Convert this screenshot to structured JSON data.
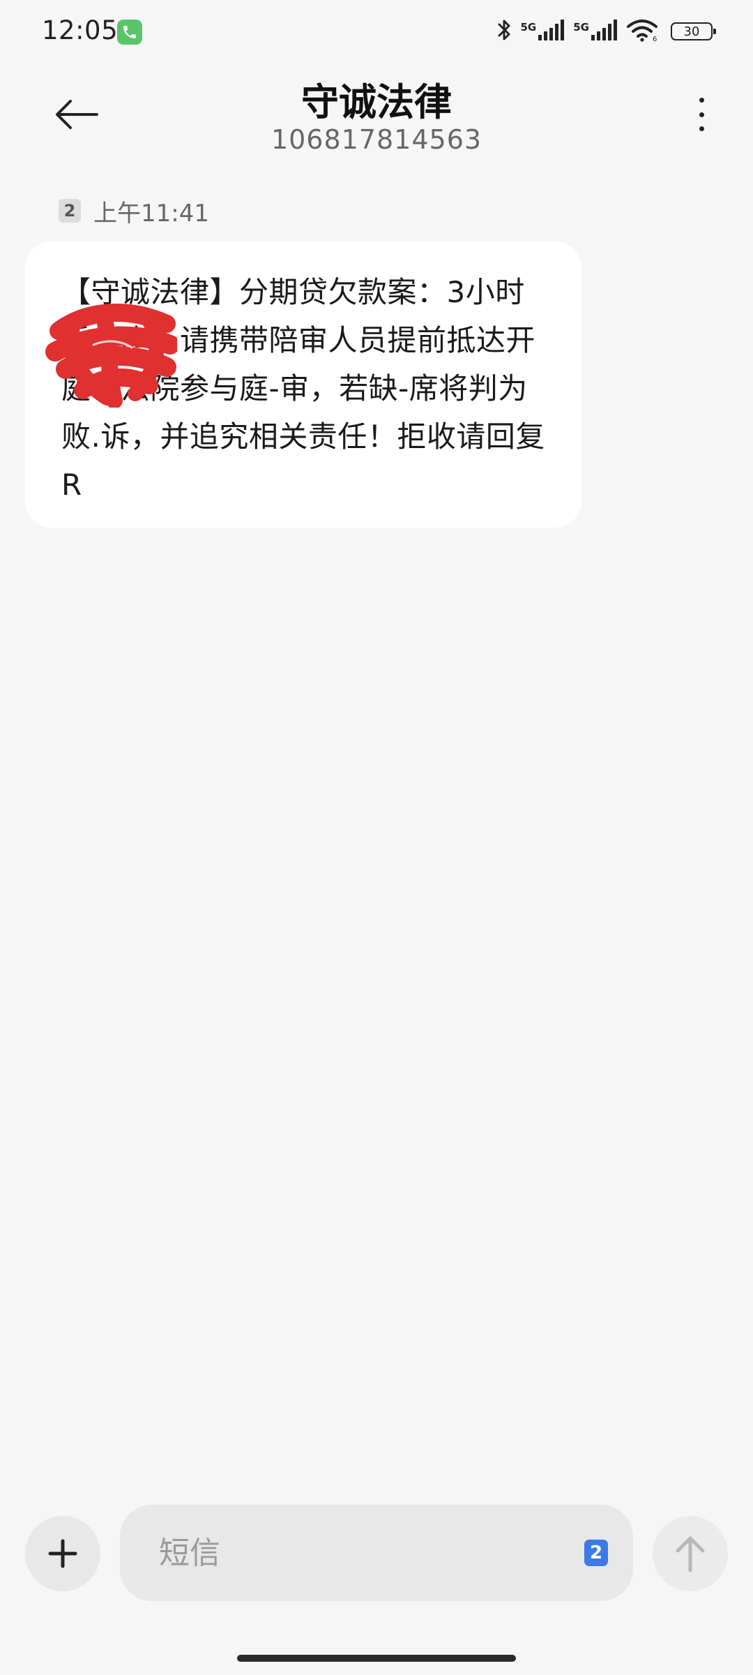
{
  "status_bar": {
    "time": "12:05",
    "network_1": "5G",
    "network_2": "5G",
    "battery": "30",
    "icons": [
      "phone-call-icon",
      "bluetooth-icon",
      "signal-icon",
      "signal-icon",
      "wifi-icon",
      "battery-icon"
    ]
  },
  "header": {
    "back_icon": "arrow-left-icon",
    "contact_name": "守诚法律",
    "contact_number": "106817814563",
    "more_icon": "more-vertical-icon"
  },
  "messages": [
    {
      "sim": "2",
      "time": "上午11:41",
      "text": "【守诚法律】分期贷欠款案：3小时后上庭，请携带陪审人员提前抵达开庭地法院参与庭-审，若缺-席将判为败.诉，并追究相关责任！拒收请回复R",
      "redacted": true
    }
  ],
  "composer": {
    "add_icon": "plus-icon",
    "placeholder": "短信",
    "sim": "2",
    "send_icon": "arrow-up-icon"
  },
  "colors": {
    "background": "#f6f6f6",
    "bubble": "#ffffff",
    "input": "#e8e8e8",
    "sim_badge_active": "#3d7ae8",
    "call_indicator": "#5ac46a",
    "redaction": "#e03030"
  }
}
